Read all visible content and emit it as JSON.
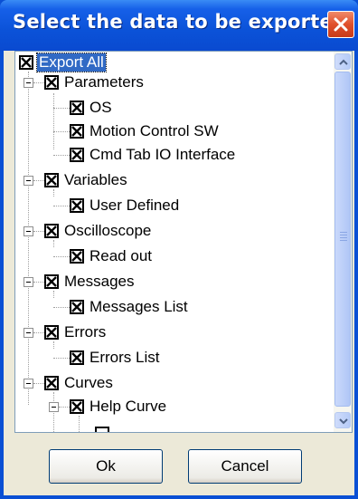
{
  "window": {
    "title": "Select the data to be exported."
  },
  "tree": {
    "root": {
      "label": "Export All",
      "checked": true,
      "selected": true
    },
    "nodes": [
      {
        "label": "Parameters",
        "checked": true
      },
      {
        "label": "OS",
        "checked": true
      },
      {
        "label": "Motion Control SW",
        "checked": true
      },
      {
        "label": "Cmd Tab IO Interface",
        "checked": true
      },
      {
        "label": "Variables",
        "checked": true
      },
      {
        "label": "User Defined",
        "checked": true
      },
      {
        "label": "Oscilloscope",
        "checked": true
      },
      {
        "label": "Read out",
        "checked": true
      },
      {
        "label": "Messages",
        "checked": true
      },
      {
        "label": "Messages List",
        "checked": true
      },
      {
        "label": "Errors",
        "checked": true
      },
      {
        "label": "Errors List",
        "checked": true
      },
      {
        "label": "Curves",
        "checked": true
      },
      {
        "label": "Help Curve",
        "checked": true
      }
    ]
  },
  "buttons": {
    "ok": "Ok",
    "cancel": "Cancel"
  },
  "colors": {
    "title_bar": "#0a4fd4",
    "selection": "#316ac5",
    "close_button": "#e0502c",
    "dialog_face": "#ece9d8"
  }
}
